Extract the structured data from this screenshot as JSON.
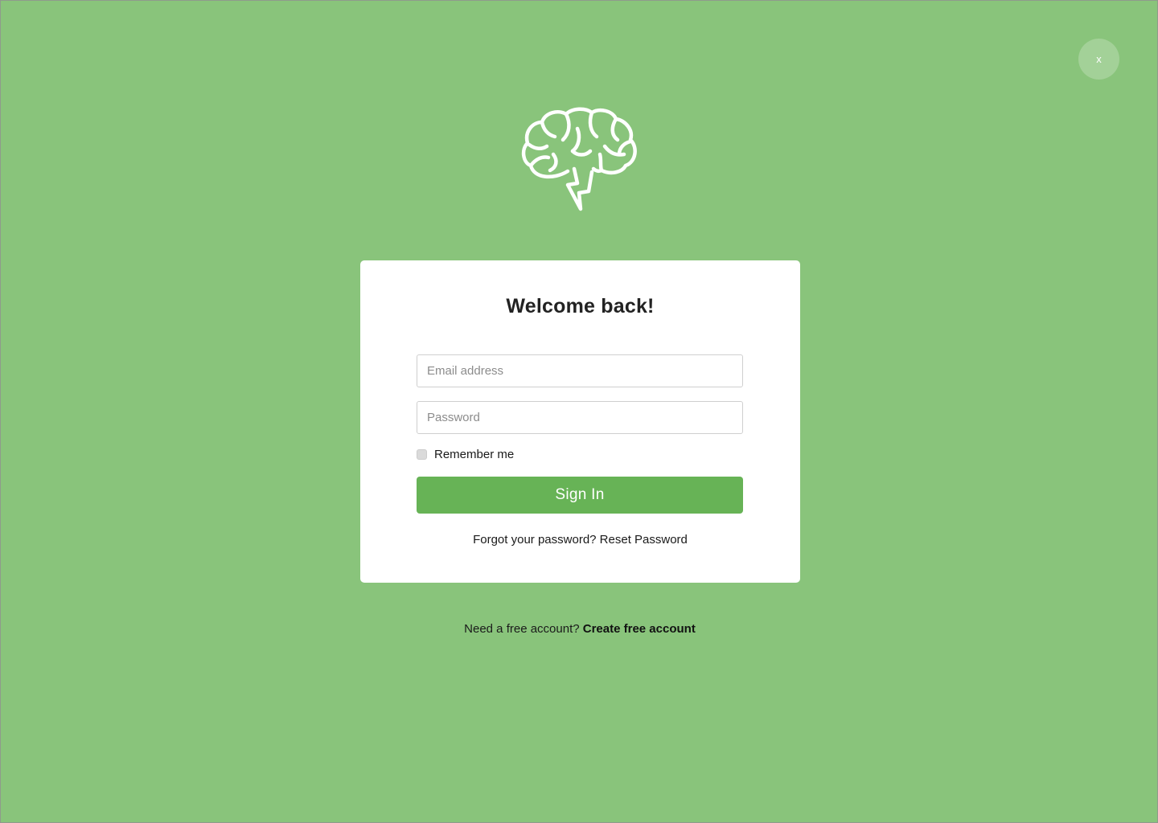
{
  "close_button": {
    "label": "x"
  },
  "logo": {
    "icon": "brain-lightning-icon"
  },
  "login_card": {
    "title": "Welcome back!",
    "email_placeholder": "Email address",
    "password_placeholder": "Password",
    "remember_label": "Remember me",
    "remember_checked": false,
    "signin_label": "Sign In",
    "forgot_text": "Forgot your password?",
    "reset_link": "Reset Password"
  },
  "footer": {
    "prompt": "Need a free account?",
    "create_link": "Create free account"
  },
  "colors": {
    "background": "#89c47b",
    "primary_button": "#67b356",
    "card": "#ffffff"
  }
}
